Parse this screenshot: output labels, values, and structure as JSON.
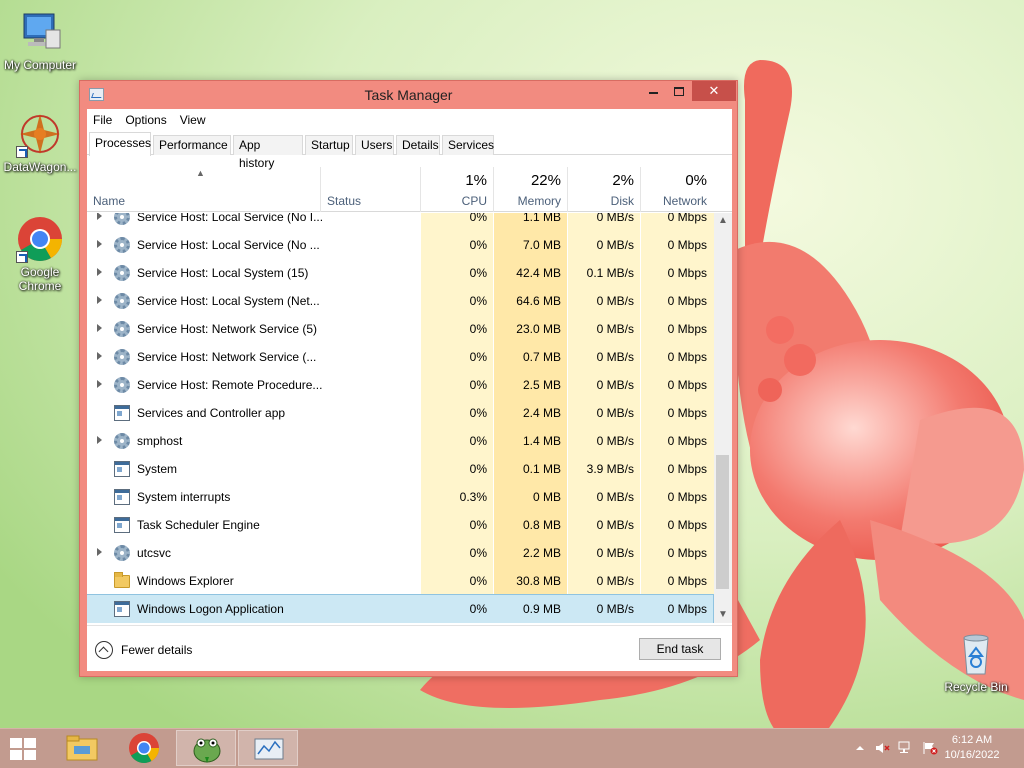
{
  "desktop": {
    "icons": [
      {
        "label": "My Computer",
        "icon": "computer-icon"
      },
      {
        "label": "DataWagon...",
        "icon": "datawagon-icon"
      },
      {
        "label": "Google Chrome",
        "icon": "chrome-icon"
      },
      {
        "label": "Recycle Bin",
        "icon": "recycle-bin-icon"
      }
    ]
  },
  "window": {
    "title": "Task Manager",
    "menu": [
      "File",
      "Options",
      "View"
    ],
    "tabs": [
      "Processes",
      "Performance",
      "App history",
      "Startup",
      "Users",
      "Details",
      "Services"
    ],
    "active_tab": "Processes",
    "columns": {
      "name": {
        "label": "Name"
      },
      "status": {
        "label": "Status"
      },
      "cpu": {
        "pct": "1%",
        "label": "CPU"
      },
      "memory": {
        "pct": "22%",
        "label": "Memory"
      },
      "disk": {
        "pct": "2%",
        "label": "Disk"
      },
      "network": {
        "pct": "0%",
        "label": "Network"
      }
    },
    "rows": [
      {
        "name": "Service Host: Local Service (No I...",
        "icon": "gear-icon",
        "expandable": true,
        "cpu": "0%",
        "memory": "1.1 MB",
        "disk": "0 MB/s",
        "network": "0 Mbps"
      },
      {
        "name": "Service Host: Local Service (No ...",
        "icon": "gear-icon",
        "expandable": true,
        "cpu": "0%",
        "memory": "7.0 MB",
        "disk": "0 MB/s",
        "network": "0 Mbps"
      },
      {
        "name": "Service Host: Local System (15)",
        "icon": "gear-icon",
        "expandable": true,
        "cpu": "0%",
        "memory": "42.4 MB",
        "disk": "0.1 MB/s",
        "network": "0 Mbps"
      },
      {
        "name": "Service Host: Local System (Net...",
        "icon": "gear-icon",
        "expandable": true,
        "cpu": "0%",
        "memory": "64.6 MB",
        "disk": "0 MB/s",
        "network": "0 Mbps"
      },
      {
        "name": "Service Host: Network Service (5)",
        "icon": "gear-icon",
        "expandable": true,
        "cpu": "0%",
        "memory": "23.0 MB",
        "disk": "0 MB/s",
        "network": "0 Mbps"
      },
      {
        "name": "Service Host: Network Service (...",
        "icon": "gear-icon",
        "expandable": true,
        "cpu": "0%",
        "memory": "0.7 MB",
        "disk": "0 MB/s",
        "network": "0 Mbps"
      },
      {
        "name": "Service Host: Remote Procedure...",
        "icon": "gear-icon",
        "expandable": true,
        "cpu": "0%",
        "memory": "2.5 MB",
        "disk": "0 MB/s",
        "network": "0 Mbps"
      },
      {
        "name": "Services and Controller app",
        "icon": "window-icon",
        "expandable": false,
        "cpu": "0%",
        "memory": "2.4 MB",
        "disk": "0 MB/s",
        "network": "0 Mbps"
      },
      {
        "name": "smphost",
        "icon": "gear-icon",
        "expandable": true,
        "cpu": "0%",
        "memory": "1.4 MB",
        "disk": "0 MB/s",
        "network": "0 Mbps"
      },
      {
        "name": "System",
        "icon": "window-icon",
        "expandable": false,
        "cpu": "0%",
        "memory": "0.1 MB",
        "disk": "3.9 MB/s",
        "network": "0 Mbps"
      },
      {
        "name": "System interrupts",
        "icon": "window-icon",
        "expandable": false,
        "cpu": "0.3%",
        "memory": "0 MB",
        "disk": "0 MB/s",
        "network": "0 Mbps"
      },
      {
        "name": "Task Scheduler Engine",
        "icon": "window-icon",
        "expandable": false,
        "cpu": "0%",
        "memory": "0.8 MB",
        "disk": "0 MB/s",
        "network": "0 Mbps"
      },
      {
        "name": "utcsvc",
        "icon": "gear-icon",
        "expandable": true,
        "cpu": "0%",
        "memory": "2.2 MB",
        "disk": "0 MB/s",
        "network": "0 Mbps"
      },
      {
        "name": "Windows Explorer",
        "icon": "folder-icon",
        "expandable": false,
        "cpu": "0%",
        "memory": "30.8 MB",
        "disk": "0 MB/s",
        "network": "0 Mbps"
      },
      {
        "name": "Windows Logon Application",
        "icon": "window-icon",
        "expandable": false,
        "selected": true,
        "cpu": "0%",
        "memory": "0.9 MB",
        "disk": "0 MB/s",
        "network": "0 Mbps"
      }
    ],
    "fewer_details": "Fewer details",
    "end_task": "End task"
  },
  "taskbar": {
    "items": [
      "file-explorer-icon",
      "chrome-icon",
      "frog-app-icon",
      "task-manager-icon"
    ],
    "clock_time": "6:12 AM",
    "clock_date": "10/16/2022"
  },
  "colors": {
    "window_frame": "#f28b80",
    "close_button": "#c7504a",
    "heat_light": "#fff5cc",
    "heat_medium": "#ffe8a8",
    "selected_row": "#cce8f4",
    "taskbar": "#c29b8f"
  }
}
